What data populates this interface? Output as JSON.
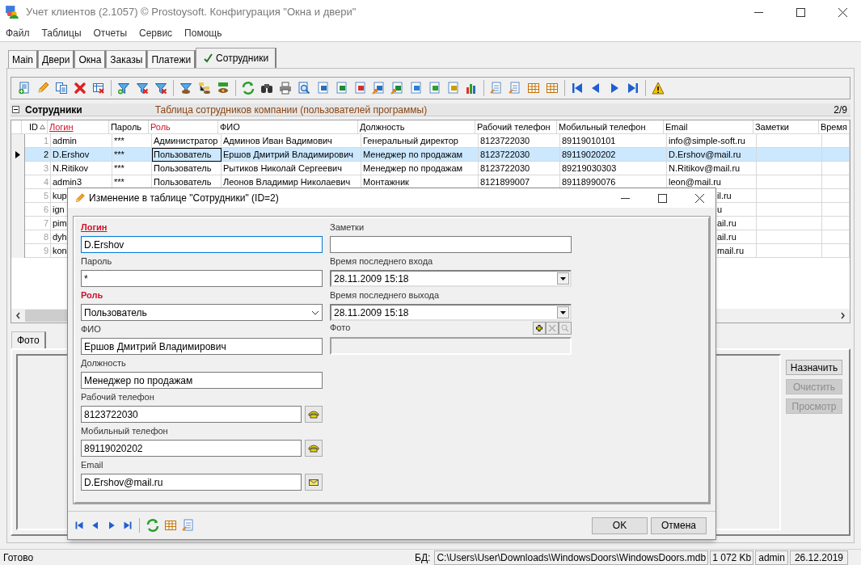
{
  "window": {
    "title": "Учет клиентов (2.1057) © Prostoysoft. Конфигурация \"Окна и двери\""
  },
  "menu": [
    "Файл",
    "Таблицы",
    "Отчеты",
    "Сервис",
    "Помощь"
  ],
  "tabs": [
    {
      "label": "Main",
      "selected": false
    },
    {
      "label": "Двери",
      "selected": false
    },
    {
      "label": "Окна",
      "selected": false
    },
    {
      "label": "Заказы",
      "selected": false
    },
    {
      "label": "Платежи",
      "selected": false
    },
    {
      "label": "Сотрудники",
      "selected": true
    }
  ],
  "table_header": {
    "title": "Сотрудники",
    "description": "Таблица сотрудников компании (пользователей программы)",
    "position": "2/9"
  },
  "table": {
    "columns": [
      {
        "label": "ID",
        "kind": "plain",
        "sorted": true
      },
      {
        "label": "Логин",
        "kind": "key",
        "sorted": false
      },
      {
        "label": "Пароль",
        "kind": "plain",
        "sorted": false
      },
      {
        "label": "Роль",
        "kind": "required",
        "sorted": false
      },
      {
        "label": "ФИО",
        "kind": "plain",
        "sorted": false
      },
      {
        "label": "Должность",
        "kind": "plain",
        "sorted": false
      },
      {
        "label": "Рабочий телефон",
        "kind": "plain",
        "sorted": false
      },
      {
        "label": "Мобильный телефон",
        "kind": "plain",
        "sorted": false
      },
      {
        "label": "Email",
        "kind": "plain",
        "sorted": false
      },
      {
        "label": "Заметки",
        "kind": "plain",
        "sorted": false
      },
      {
        "label": "Время",
        "kind": "plain",
        "sorted": false
      }
    ],
    "rows": [
      {
        "kind": "full",
        "selected": false,
        "cells": [
          "1",
          "admin",
          "***",
          "Администратор",
          "Админов Иван Вадимович",
          "Генеральный директор",
          "8123722030",
          "89119010101",
          "info@simple-soft.ru"
        ]
      },
      {
        "kind": "full",
        "selected": true,
        "cells": [
          "2",
          "D.Ershov",
          "***",
          "Пользователь",
          "Ершов Дмитрий Владимирович",
          "Менеджер по продажам",
          "8123722030",
          "89119020202",
          "D.Ershov@mail.ru"
        ]
      },
      {
        "kind": "full",
        "selected": false,
        "cells": [
          "3",
          "N.Ritikov",
          "***",
          "Пользователь",
          "Рытиков Николай Сергеевич",
          "Менеджер по продажам",
          "8123722030",
          "89219030303",
          "N.Ritikov@mail.ru"
        ]
      },
      {
        "kind": "full",
        "selected": false,
        "cells": [
          "4",
          "admin3",
          "***",
          "Пользователь",
          "Леонов Владимир Николаевич",
          "Монтажник",
          "8121899007",
          "89118990076",
          "leon@mail.ru"
        ]
      },
      {
        "kind": "partial",
        "selected": false,
        "cells": [
          "5",
          "kup"
        ],
        "email_tail": "il.ru"
      },
      {
        "kind": "partial",
        "selected": false,
        "cells": [
          "6",
          "ign"
        ],
        "email_tail": "u"
      },
      {
        "kind": "partial",
        "selected": false,
        "cells": [
          "7",
          "pim"
        ],
        "email_tail": "ail.ru"
      },
      {
        "kind": "partial",
        "selected": false,
        "cells": [
          "8",
          "dyh"
        ],
        "email_tail": "ail.ru"
      },
      {
        "kind": "partial",
        "selected": false,
        "cells": [
          "9",
          "kon"
        ],
        "email_tail": "mail.ru"
      }
    ]
  },
  "photo_panel": {
    "tab": "Фото",
    "buttons": [
      {
        "label": "Назначить",
        "disabled": false
      },
      {
        "label": "Очистить",
        "disabled": true
      },
      {
        "label": "Просмотр",
        "disabled": true
      }
    ]
  },
  "dialog": {
    "title": "Изменение в таблице \"Сотрудники\" (ID=2)",
    "left_fields": [
      {
        "label": "Логин",
        "required": true,
        "key": true,
        "kind": "text",
        "value": "D.Ershov",
        "focused": true
      },
      {
        "label": "Пароль",
        "required": false,
        "key": false,
        "kind": "text",
        "value": "*",
        "focused": false
      },
      {
        "label": "Роль",
        "required": true,
        "key": false,
        "kind": "select",
        "value": "Пользователь",
        "focused": false
      },
      {
        "label": "ФИО",
        "required": false,
        "key": false,
        "kind": "text",
        "value": "Ершов Дмитрий Владимирович",
        "focused": false
      },
      {
        "label": "Должность",
        "required": false,
        "key": false,
        "kind": "text",
        "value": "Менеджер по продажам",
        "focused": false
      },
      {
        "label": "Рабочий телефон",
        "required": false,
        "key": false,
        "kind": "phone",
        "value": "8123722030",
        "focused": false
      },
      {
        "label": "Мобильный телефон",
        "required": false,
        "key": false,
        "kind": "phone",
        "value": "89119020202",
        "focused": false
      },
      {
        "label": "Email",
        "required": false,
        "key": false,
        "kind": "email",
        "value": "D.Ershov@mail.ru",
        "focused": false
      }
    ],
    "right_fields": [
      {
        "label": "Заметки",
        "required": false,
        "key": false,
        "kind": "text",
        "focused": false
      },
      {
        "label": "Время последнего входа",
        "required": false,
        "key": false,
        "kind": "datetime",
        "value": "28.11.2009 15:18"
      },
      {
        "label": "Время последнего выхода",
        "required": false,
        "key": false,
        "kind": "datetime",
        "value": "28.11.2009 15:18"
      },
      {
        "label": "Фото",
        "required": false,
        "key": false,
        "kind": "photo"
      }
    ],
    "photo_tools": [
      {
        "kind": "add",
        "disabled": false
      },
      {
        "kind": "delete",
        "disabled": true
      },
      {
        "kind": "view",
        "disabled": true
      }
    ],
    "buttons": [
      "OK",
      "Отмена"
    ]
  },
  "status_bar": {
    "status": "Готово",
    "db_label": "БД:",
    "db_path": "C:\\Users\\User\\Downloads\\WindowsDoors\\WindowsDoors.mdb",
    "size": "1 072 Kb",
    "user": "admin",
    "date": "26.12.2019"
  }
}
